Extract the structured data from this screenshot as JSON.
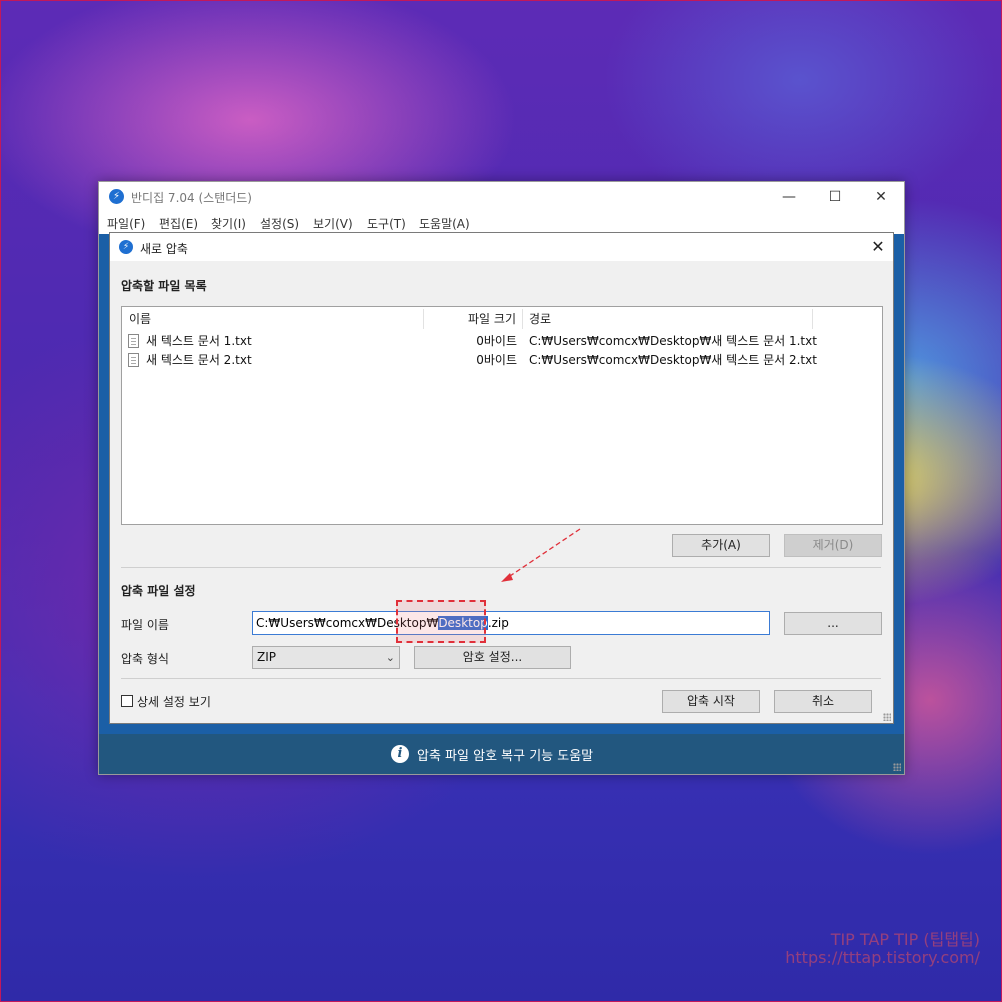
{
  "app": {
    "title": "반디집 7.04 (스탠더드)",
    "window_controls": {
      "minimize": "—",
      "maximize": "☐",
      "close": "✕"
    },
    "menu": [
      "파일(F)",
      "편집(E)",
      "찾기(I)",
      "설정(S)",
      "보기(V)",
      "도구(T)",
      "도움말(A)"
    ],
    "footer_text": "압축 파일 암호 복구 기능 도움말"
  },
  "dialog": {
    "title": "새로 압축",
    "close_symbol": "✕",
    "file_list_section": "압축할 파일 목록",
    "columns": [
      "이름",
      "파일 크기",
      "경로"
    ],
    "files": [
      {
        "name": "새 텍스트 문서 1.txt",
        "size": "0바이트",
        "path": "C:₩Users₩comcx₩Desktop₩새 텍스트 문서 1.txt"
      },
      {
        "name": "새 텍스트 문서 2.txt",
        "size": "0바이트",
        "path": "C:₩Users₩comcx₩Desktop₩새 텍스트 문서 2.txt"
      }
    ],
    "add_button": "추가(A)",
    "remove_button": "제거(D)",
    "archive_section": "압축 파일 설정",
    "filename_label": "파일 이름",
    "filename_prefix": "C:₩Users₩comcx₩Desktop₩",
    "filename_selected": "Desktop",
    "filename_suffix": ".zip",
    "browse_button": "...",
    "format_label": "압축 형식",
    "format_value": "ZIP",
    "password_button": "암호 설정...",
    "details_checkbox": "상세 설정 보기",
    "start_button": "압축 시작",
    "cancel_button": "취소"
  },
  "watermark": {
    "line1": "TIP TAP TIP (팁탭팁)",
    "line2": "https://tttap.tistory.com/"
  },
  "colors": {
    "accent": "#2c6bd1",
    "annotation": "#e0303a",
    "footer": "#22577f"
  }
}
